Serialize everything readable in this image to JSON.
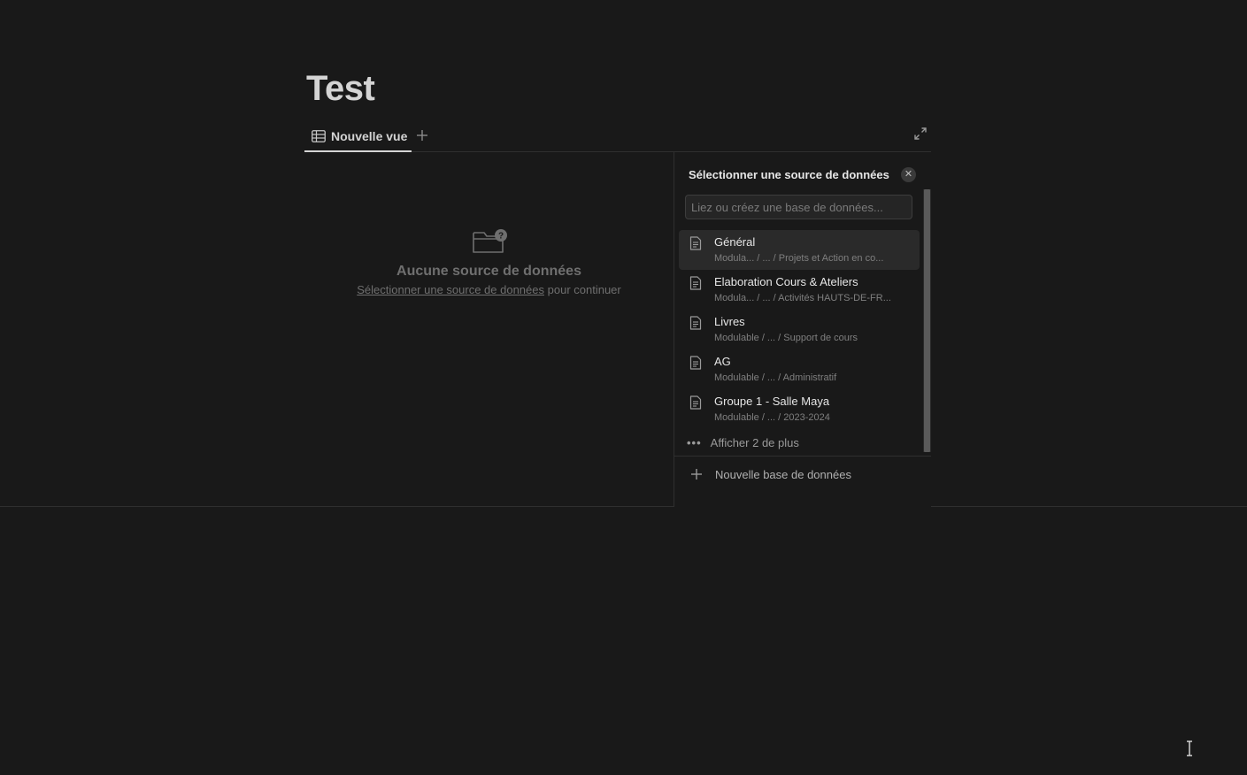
{
  "page": {
    "title": "Test"
  },
  "tabs": [
    {
      "label": "Nouvelle vue",
      "icon": "table-icon",
      "active": true
    }
  ],
  "empty_state": {
    "icon": "folder-question-icon",
    "title": "Aucune source de données",
    "link_text": "Sélectionner une source de données",
    "suffix_text": "pour continuer"
  },
  "panel": {
    "title": "Sélectionner une source de données",
    "search_placeholder": "Liez ou créez une base de données...",
    "items": [
      {
        "name": "Général",
        "path": "Modula...  / ... / Projets et Action en co...",
        "selected": true
      },
      {
        "name": "Elaboration Cours & Ateliers",
        "path": "Modula...  / ... / Activités HAUTS-DE-FR...",
        "selected": false
      },
      {
        "name": "Livres",
        "path": "Modulable / ... / Support de cours",
        "selected": false
      },
      {
        "name": "AG",
        "path": "Modulable / ... / Administratif",
        "selected": false
      },
      {
        "name": "Groupe 1 - Salle Maya",
        "path": "Modulable / ... / 2023-2024",
        "selected": false
      }
    ],
    "show_more": "Afficher 2 de plus",
    "new_database": "Nouvelle base de données"
  },
  "colors": {
    "background": "#191919",
    "text": "#d4d4d4",
    "muted": "#6f6f6f",
    "selected_row": "#2a2a2a"
  }
}
